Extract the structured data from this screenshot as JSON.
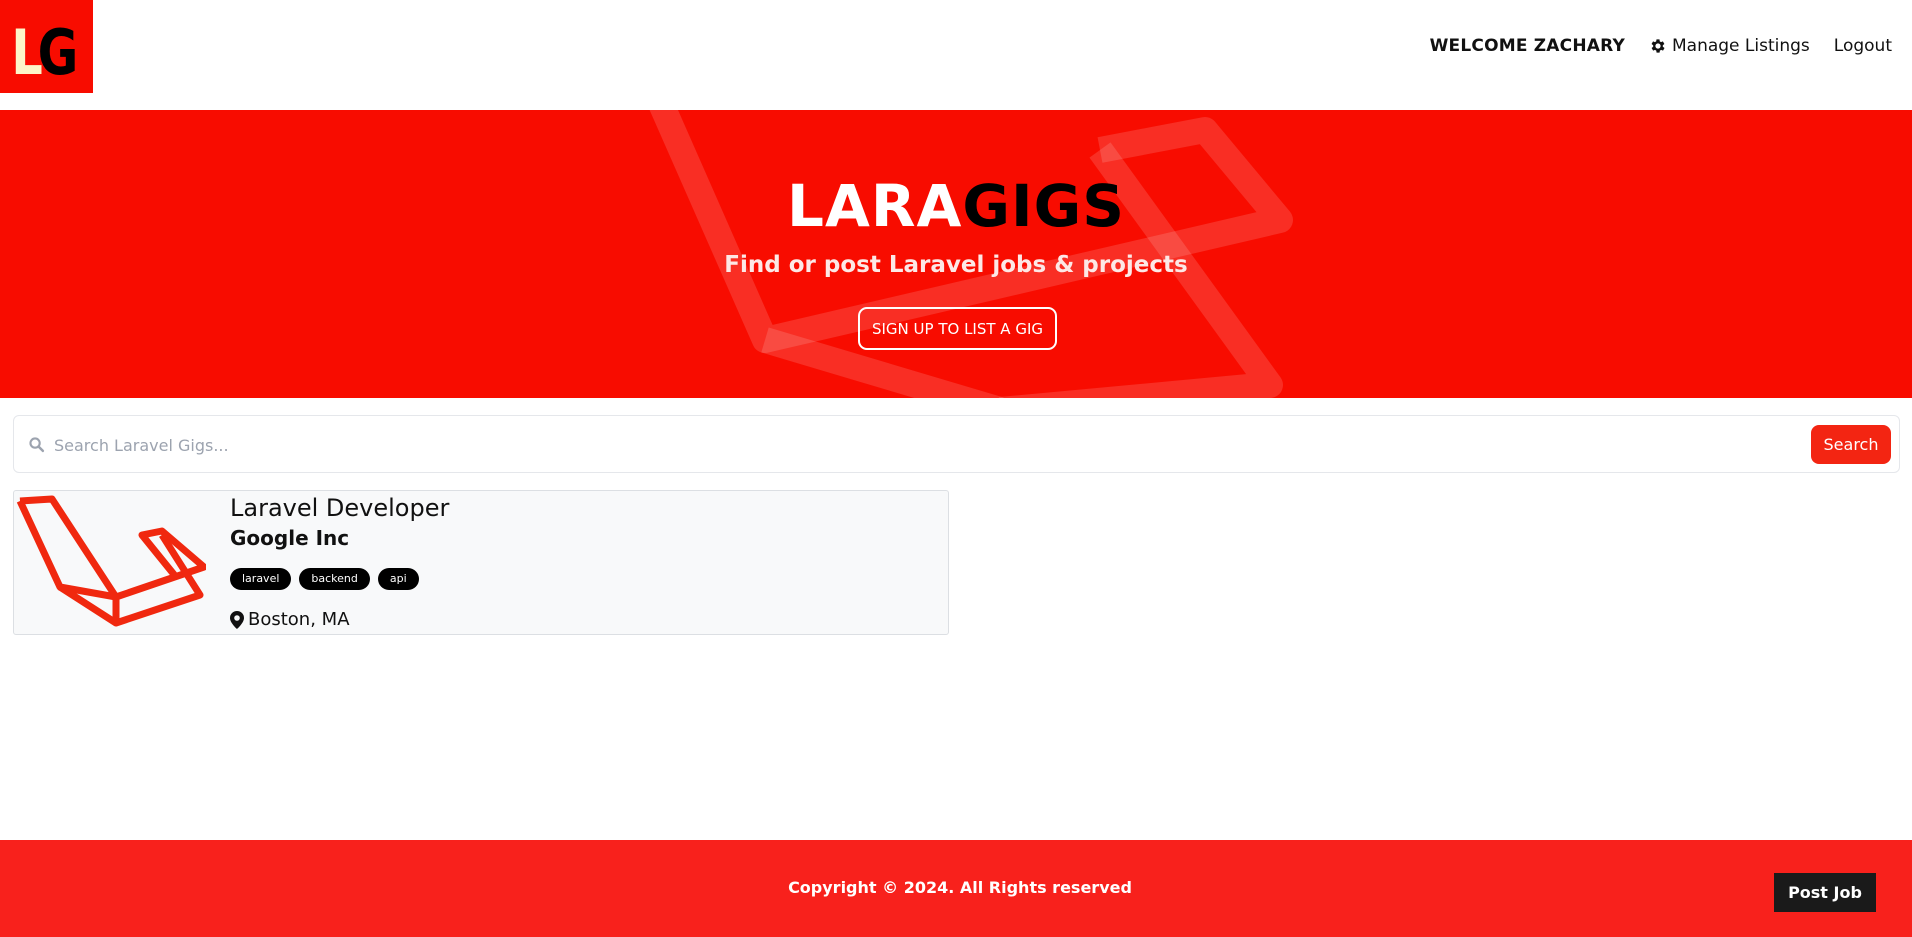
{
  "nav": {
    "logo_alt": "LG",
    "welcome": "WELCOME ZACHARY",
    "manage_label": "Manage Listings",
    "manage_icon": "gear-icon",
    "logout_label": "Logout"
  },
  "hero": {
    "title_white": "LARA",
    "title_black": "GIGS",
    "subtitle": "Find or post Laravel jobs & projects",
    "button_label": "SIGN UP TO LIST A GIG"
  },
  "search": {
    "icon": "search-icon",
    "placeholder": "Search Laravel Gigs...",
    "value": "",
    "button_label": "Search"
  },
  "listings": [
    {
      "title": "Laravel Developer",
      "company": "Google Inc",
      "tags": [
        "laravel",
        "backend",
        "api"
      ],
      "location": "Boston, MA",
      "location_icon": "map-pin-icon"
    }
  ],
  "footer": {
    "copyright": "Copyright © 2024. All Rights reserved",
    "post_job_label": "Post Job"
  },
  "colors": {
    "brand_red": "#f80c00",
    "footer_red": "#f8211c",
    "button_red": "#f32512",
    "tag_black": "#000000"
  }
}
